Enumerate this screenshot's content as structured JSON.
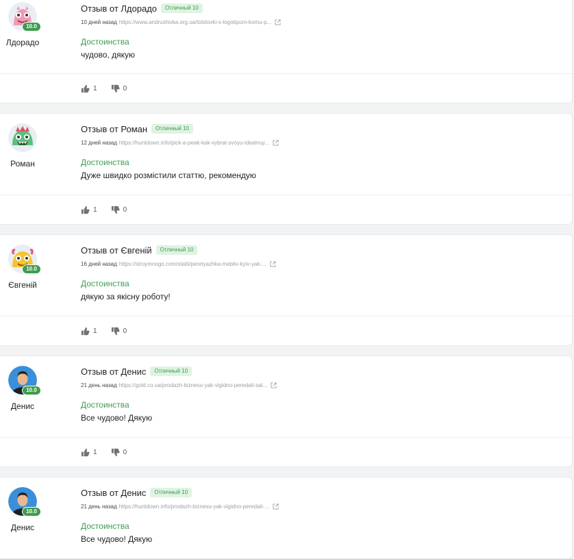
{
  "colors": {
    "accent_green": "#3e9c53",
    "badge_bg": "#dff3e2",
    "card_bg": "#ffffff",
    "page_bg": "#f2f3f5"
  },
  "labels": {
    "pros": "Достоинства"
  },
  "reviews": [
    {
      "author": "Лдорадо",
      "avatar_icon": "pink-monster-avatar",
      "score": "10.0",
      "title": "Отзыв от Лдорадо",
      "rating": "Отличный 10",
      "date": "10 дней назад",
      "url": "https://www.andrushivka.org.ua/tolstovki-s-logotipom-komu-p...",
      "text": "чудово, дякую",
      "likes": "1",
      "dislikes": "0"
    },
    {
      "author": "Роман",
      "avatar_icon": "green-monster-avatar",
      "score": "",
      "title": "Отзыв от Роман",
      "rating": "Отличный 10",
      "date": "12 дней назад",
      "url": "https://huntdown.info/pick-a-peak-kak-vybrat-svoyu-idealnuy...",
      "text": "Дуже швидко розмістили статтю, рекомендую",
      "likes": "1",
      "dislikes": "0"
    },
    {
      "author": "Євгеній",
      "avatar_icon": "yellow-monster-avatar",
      "score": "10.0",
      "title": "Отзыв от Євгеній",
      "rating": "Отличный 10",
      "date": "16 дней назад",
      "url": "https://stroymnogo.com/statti/peretyazhka-mebliv-kyiv-yak-...",
      "text": "дякую за якісну роботу!",
      "likes": "1",
      "dislikes": "0"
    },
    {
      "author": "Денис",
      "avatar_icon": "user-photo-avatar",
      "score": "10.0",
      "title": "Отзыв от Денис",
      "rating": "Отличный 10",
      "date": "21 день назад",
      "url": "https://gold.co.ua/prodazh-biznesu-yak-vigidno-peredati-sal...",
      "text": "Все чудово! Дякую",
      "likes": "1",
      "dislikes": "0"
    },
    {
      "author": "Денис",
      "avatar_icon": "user-photo-avatar",
      "score": "10.0",
      "title": "Отзыв от Денис",
      "rating": "Отличный 10",
      "date": "21 день назад",
      "url": "https://huntdown.info/prodazh-biznesu-yak-vigidno-peredati-...",
      "text": "Все чудово! Дякую",
      "likes": "",
      "dislikes": ""
    }
  ]
}
